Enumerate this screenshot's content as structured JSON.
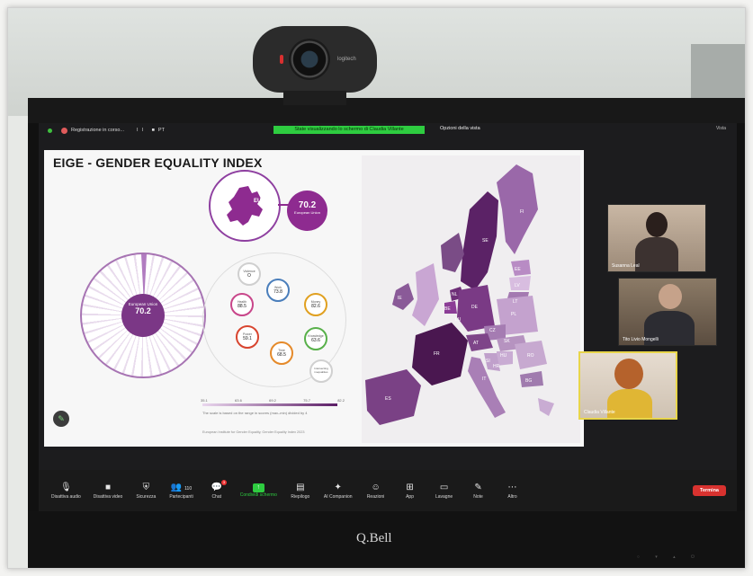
{
  "zoom": {
    "recording_text": "Registrazione in corso...",
    "recording_controls": "II ■",
    "recording_code": "PT",
    "share_banner": "State visualizzando lo schermo di Claudia Villante",
    "view_options": "Opzioni della vista",
    "view_right": "Vista"
  },
  "slide": {
    "title": "EIGE - GENDER EQUALITY INDEX",
    "eu_label": "EU",
    "eu_score": "70.2",
    "eu_score_label": "European Union",
    "dial_label": "European Union",
    "dial_score": "70.2",
    "domains": [
      {
        "label": "Work",
        "value": "73.8"
      },
      {
        "label": "Money",
        "value": "82.6"
      },
      {
        "label": "Knowledge",
        "value": "63.6"
      },
      {
        "label": "Time",
        "value": "68.5"
      },
      {
        "label": "Power",
        "value": "59.1"
      },
      {
        "label": "Health",
        "value": "88.5"
      },
      {
        "label": "Violence",
        "value": "O"
      }
    ],
    "intersecting_label": "Intersecting inequalities",
    "scale_ticks": [
      "35.1",
      "63.6",
      "69.2",
      "75.7",
      "82.2"
    ],
    "scale_note": "The scale is based on the range in scores (max–min) divided by 4",
    "source_note": "European Institute for Gender Equality, Gender Equality Index 2023",
    "map_labels": [
      "SE",
      "FI",
      "EE",
      "LV",
      "LT",
      "IE",
      "NL",
      "BE",
      "DE",
      "LU",
      "CZ",
      "PL",
      "FR",
      "AT",
      "SK",
      "HU",
      "SI",
      "RO",
      "BG",
      "ES",
      "IT",
      "HR"
    ]
  },
  "participants": [
    {
      "name": "Susanna Leal"
    },
    {
      "name": "Tito Livio Mongelli"
    },
    {
      "name": "Claudia Villante"
    }
  ],
  "toolbar": {
    "audio": "Disattiva audio",
    "video": "Disattiva video",
    "security": "Sicurezza",
    "participants": "Partecipanti",
    "participants_count": "110",
    "chat": "Chat",
    "chat_badge": "3",
    "share": "Condividi schermo",
    "summary": "Riepilogo",
    "ai": "AI Companion",
    "reactions": "Reazioni",
    "apps": "App",
    "whiteboard": "Lavagne",
    "notes": "Note",
    "more": "Altro",
    "end": "Termina"
  },
  "monitor": {
    "brand": "Q.Bell"
  },
  "webcam": {
    "brand": "logitech"
  }
}
